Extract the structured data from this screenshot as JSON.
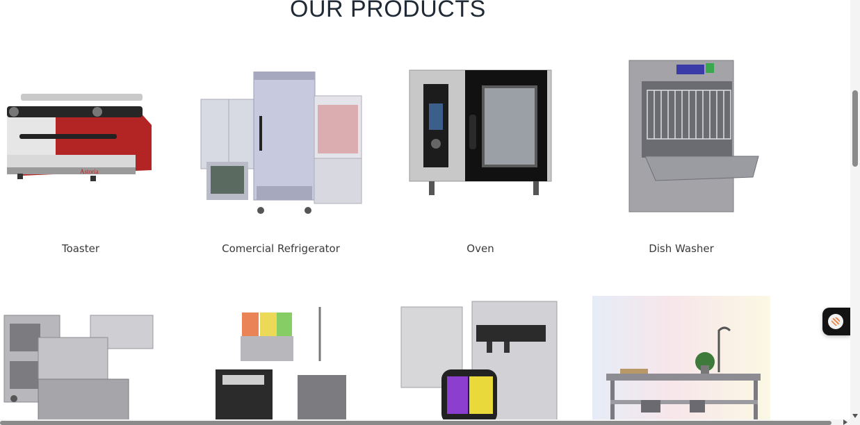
{
  "section": {
    "title": "OUR PRODUCTS"
  },
  "products": [
    {
      "name": "Toaster",
      "icon": "espresso-machine-image"
    },
    {
      "name": "Comercial Refrigerator",
      "icon": "refrigerator-image"
    },
    {
      "name": "Oven",
      "icon": "combi-oven-image"
    },
    {
      "name": "Dish Washer",
      "icon": "dish-washer-image"
    },
    {
      "name": "",
      "icon": "range-oven-image"
    },
    {
      "name": "",
      "icon": "juice-dispenser-image"
    },
    {
      "name": "",
      "icon": "ice-cream-machine-image"
    },
    {
      "name": "",
      "icon": "stainless-work-table-image"
    }
  ],
  "chat": {
    "icon": "chat-avatar-icon"
  },
  "colors": {
    "title": "#1f2a36",
    "label": "#3a3a3a",
    "chat_bg": "#131313"
  }
}
